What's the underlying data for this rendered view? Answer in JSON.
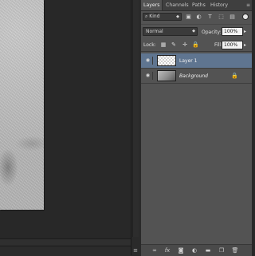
{
  "panel": {
    "tabs": [
      {
        "label": "Layers",
        "active": true
      },
      {
        "label": "Channels",
        "active": false
      },
      {
        "label": "Paths",
        "active": false
      },
      {
        "label": "History",
        "active": false
      }
    ],
    "tabs_menu_icon": "panel-menu-icon"
  },
  "filter": {
    "kind_label": "Kind",
    "search_icon": "⌕",
    "icons": [
      "image-filter-icon",
      "adjustment-filter-icon",
      "type-filter-icon",
      "shape-filter-icon",
      "smart-object-filter-icon"
    ]
  },
  "blend": {
    "mode": "Normal",
    "opacity_label": "Opacity:",
    "opacity_value": "100%"
  },
  "lock": {
    "label": "Lock:",
    "icons": [
      "lock-transparent-pixels-icon",
      "lock-image-pixels-icon",
      "lock-position-icon",
      "lock-all-icon"
    ],
    "fill_label": "Fill:",
    "fill_value": "100%"
  },
  "layers": [
    {
      "name": "Layer 1",
      "visible": true,
      "selected": true,
      "thumbnail": "transparent",
      "locked": false
    },
    {
      "name": "Background",
      "visible": true,
      "selected": false,
      "thumbnail": "photo",
      "locked": true
    }
  ],
  "footer_icons": [
    "link-layers-icon",
    "layer-style-icon",
    "add-mask-icon",
    "adjustment-layer-icon",
    "new-group-icon",
    "new-layer-icon",
    "delete-layer-icon"
  ],
  "colors": {
    "panel_bg": "#535353",
    "selected_layer": "#5f7590",
    "canvas_bg": "#282828"
  }
}
